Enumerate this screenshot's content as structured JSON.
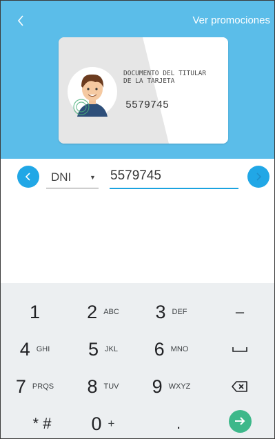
{
  "header": {
    "back_icon": "chevron-left-icon",
    "promotions_link": "Ver promociones",
    "background": "#5bbde9"
  },
  "card": {
    "label_line1": "DOCUMENTO DEL TITULAR",
    "label_line2": "DE LA TARJETA",
    "number": "5579745",
    "avatar_icon": "person-avatar-icon"
  },
  "form": {
    "prev_icon": "chevron-left-icon",
    "next_icon": "chevron-right-icon",
    "document_type": "DNI",
    "document_number": "5579745",
    "accent": "#1aa3e0"
  },
  "keyboard": {
    "keys": [
      {
        "digit": "1",
        "letters": ""
      },
      {
        "digit": "2",
        "letters": "ABC"
      },
      {
        "digit": "3",
        "letters": "DEF"
      },
      {
        "digit": "4",
        "letters": "GHI"
      },
      {
        "digit": "5",
        "letters": "JKL"
      },
      {
        "digit": "6",
        "letters": "MNO"
      },
      {
        "digit": "7",
        "letters": "PRQS"
      },
      {
        "digit": "8",
        "letters": "TUV"
      },
      {
        "digit": "9",
        "letters": "WXYZ"
      },
      {
        "digit": "0",
        "letters": "+"
      }
    ],
    "minus": "–",
    "star_hash": "* #",
    "dot": ".",
    "space_icon": "space-icon",
    "backspace_icon": "backspace-icon",
    "enter_icon": "arrow-right-icon",
    "enter_color": "#3db88a"
  }
}
